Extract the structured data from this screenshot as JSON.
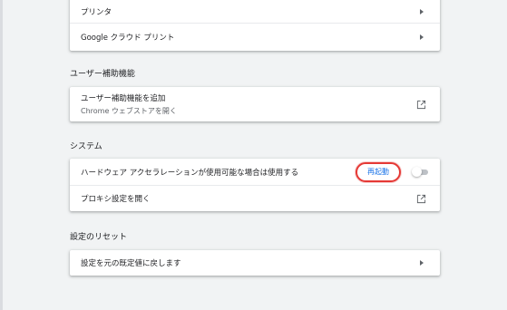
{
  "printing": {
    "items": [
      {
        "label": "プリンタ"
      },
      {
        "label": "Google クラウド プリント"
      }
    ]
  },
  "accessibility": {
    "title": "ユーザー補助機能",
    "add_label": "ユーザー補助機能を追加",
    "add_sub": "Chrome ウェブストアを開く"
  },
  "system": {
    "title": "システム",
    "hw_accel_label": "ハードウェア アクセラレーションが使用可能な場合は使用する",
    "restart_label": "再起動",
    "hw_accel_enabled": false,
    "proxy_label": "プロキシ設定を開く"
  },
  "reset": {
    "title": "設定のリセット",
    "restore_label": "設定を元の既定値に戻します"
  },
  "colors": {
    "accent": "#1a73e8",
    "highlight": "#e53935",
    "background": "#f1f3f4"
  },
  "icons": {
    "arrow": "arrow-right-icon",
    "external": "open-in-new-icon"
  }
}
